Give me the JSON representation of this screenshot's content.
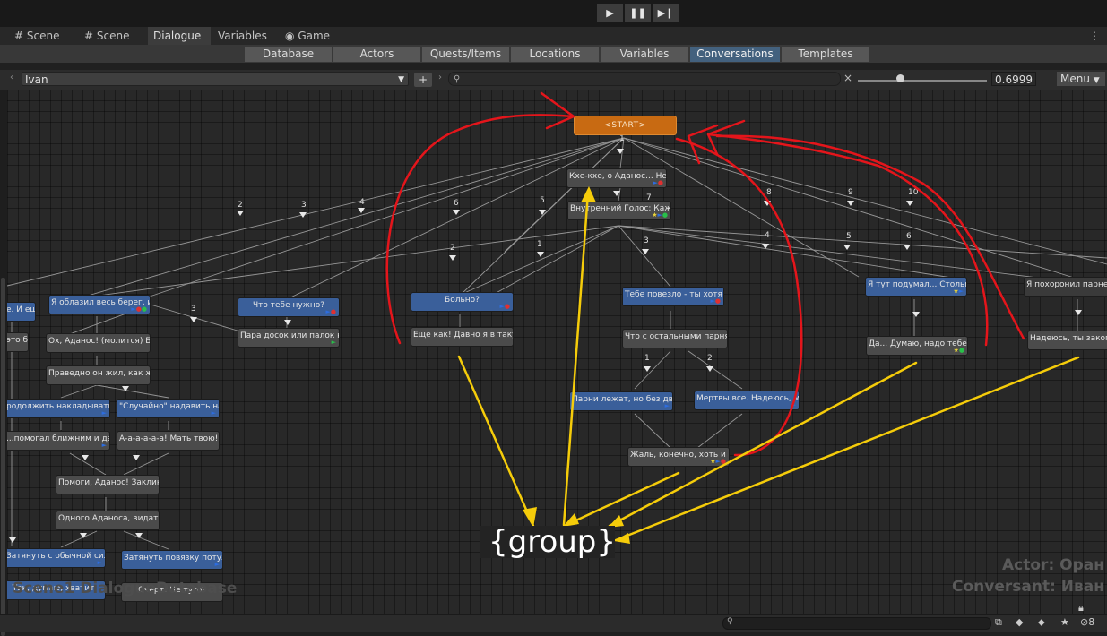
{
  "tabs": [
    {
      "label": "Scene",
      "icon": "grid-icon",
      "active": false
    },
    {
      "label": "Scene",
      "icon": "grid-icon",
      "active": false
    },
    {
      "label": "Dialogue",
      "active": true
    },
    {
      "label": "Variables",
      "active": false
    },
    {
      "label": "Game",
      "icon": "gamepad-icon",
      "active": false
    }
  ],
  "subtabs": [
    "Database",
    "Actors",
    "Quests/Items",
    "Locations",
    "Variables",
    "Conversations",
    "Templates"
  ],
  "active_subtab": "Conversations",
  "toolbar": {
    "conversation": "Ivan",
    "add_label": "+",
    "search_clear": "×",
    "zoom": "0.6999",
    "menu_label": "Menu"
  },
  "nodes": {
    "start": "<START>",
    "n_kyekye": "Кхе-кхе, о Аданос... Не по",
    "n_inner": "Внутренний Голос: Кажется,",
    "n_bolno": "Больно?",
    "n_eshche": "Еще как! Давно я в такую з",
    "n_lucky": "Тебе повезло - ты хотя бы",
    "n_others": "Что с остальными парнями?",
    "n_lying": "Парни лежат, но без движен",
    "n_dead": "Мертвы все. Надеюсь, мы им",
    "n_pity": "Жаль, конечно, хоть и не в",
    "n_think": "Я тут подумал... Столько",
    "n_yes": "Да... Думаю, надо тебе эт",
    "n_buried": "Я похоронил парней. П",
    "n_hope": "Надеюсь, ты закопал",
    "n_need": "Что тебе нужно?",
    "n_boards": "Пара досок или палок каких",
    "n_shore": "Я облазил весь берег, и не",
    "n_left1": "е. И еще",
    "n_left2": "это б",
    "n_pray": "Ох, Аданос! (молится) Благ",
    "n_righteous": "Праведно он жил, как же. В",
    "n_continue": "родолжить накладывать шин",
    "n_accident": "\"Случайно\" надавить на ран",
    "n_helped": "...помогал ближним и дальн",
    "n_aaa": "А-а-а-а-а-а! Мать твою! Б",
    "n_help": "Помоги, Аданос! Заклинаю т",
    "n_one": "Одного Аданоса, видать, ем",
    "n_tighten": "Затянуть с обычной силой",
    "n_tighter": "Затянуть повязку потуже",
    "n_enough": "Так, думаю, хватит.",
    "n_turn": "Очерт! Не туго?"
  },
  "link_numbers": [
    "1",
    "2",
    "3",
    "4",
    "5",
    "6",
    "7",
    "8",
    "9",
    "10",
    "2",
    "1",
    "3",
    "4",
    "5",
    "6",
    "1",
    "2",
    "3"
  ],
  "group_label": "{group}",
  "actor_text": "Actor: Оран",
  "conversant_text": "Conversant: Иван",
  "watermark": "Scene1 DialogueDatabase",
  "bottom_count": "8",
  "annotation_colors": {
    "red": "#e4151b",
    "yellow": "#f5cc0a"
  }
}
